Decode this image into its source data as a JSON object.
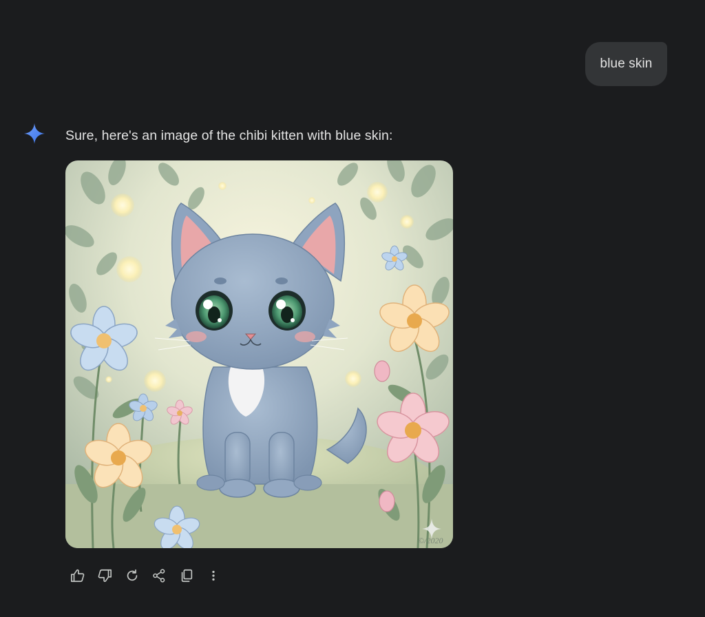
{
  "conversation": {
    "user_message": "blue skin",
    "response": {
      "text": "Sure, here's an image of the chibi kitten with blue skin:",
      "image": {
        "subject": "chibi blue kitten sitting among flowers",
        "watermark_text": "©/2020"
      },
      "actions": [
        {
          "name": "thumbs-up-icon",
          "label": "Good response"
        },
        {
          "name": "thumbs-down-icon",
          "label": "Bad response"
        },
        {
          "name": "regenerate-icon",
          "label": "Redo"
        },
        {
          "name": "share-icon",
          "label": "Share"
        },
        {
          "name": "copy-icon",
          "label": "Copy"
        },
        {
          "name": "more-vert-icon",
          "label": "More"
        }
      ]
    }
  },
  "colors": {
    "background": "#1b1c1e",
    "user_bubble": "#333537",
    "text": "#e3e3e3",
    "spark_blue": "#4b8df8",
    "icon_gray": "#c4c7c5",
    "kitten_blue": "#8fa5bf"
  }
}
